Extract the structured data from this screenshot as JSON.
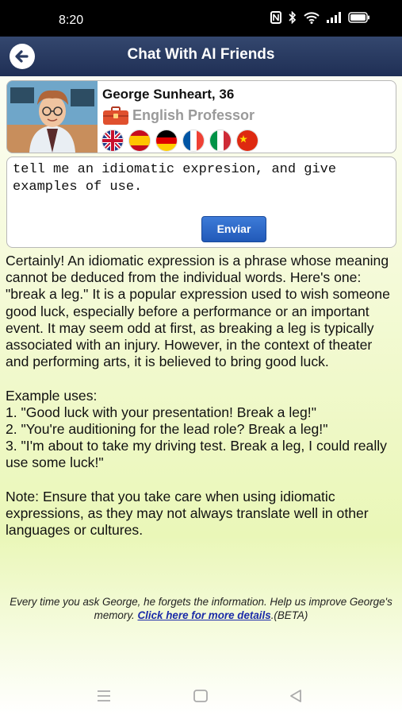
{
  "status_bar": {
    "time": "8:20",
    "icons": [
      "nfc-icon",
      "bluetooth-icon",
      "wifi-icon",
      "signal-icon",
      "battery-icon"
    ]
  },
  "header": {
    "title": "Chat With AI Friends",
    "back_icon": "back-arrow-icon"
  },
  "profile": {
    "name": "George Sunheart, 36",
    "role": "English Professor",
    "role_icon": "briefcase-icon",
    "languages": [
      "english-flag",
      "spanish-flag",
      "german-flag",
      "french-flag",
      "italian-flag",
      "chinese-flag"
    ]
  },
  "composer": {
    "value": "tell me an idiomatic expresion, and give examples of use.",
    "send_label": "Enviar"
  },
  "response": {
    "intro": "Certainly! An idiomatic expression is a phrase whose meaning cannot be deduced from the individual words. Here's one: \"break a leg.\" It is a popular expression used to wish someone good luck, especially before a performance or an important event. It may seem odd at first, as breaking a leg is typically associated with an injury. However, in the context of theater and performing arts, it is believed to bring good luck.",
    "examples_heading": "Example uses:",
    "examples": [
      "1. \"Good luck with your presentation! Break a leg!\"",
      "2. \"You're auditioning for the lead role? Break a leg!\"",
      "3. \"I'm about to take my driving test. Break a leg, I could really use some luck!\""
    ],
    "note": "Note: Ensure that you take care when using idiomatic expressions, as they may not always translate well in other languages or cultures."
  },
  "footer": {
    "text": "Every time you ask George, he forgets the information. Help us improve George's memory.",
    "link_text": "Click here for more details",
    "suffix": ".(BETA)"
  },
  "nav": [
    "menu-icon",
    "home-icon",
    "back-icon"
  ],
  "colors": {
    "header_bg": "#2a3b62",
    "send_button": "#2a66c8",
    "link": "#1a2aa8"
  }
}
